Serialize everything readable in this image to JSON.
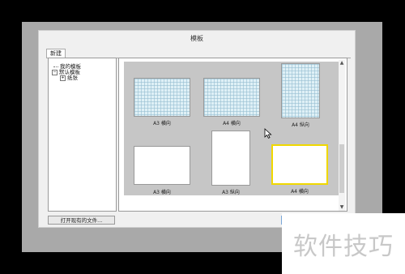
{
  "dialog": {
    "title": "模板"
  },
  "tabs": [
    {
      "label": "新建"
    }
  ],
  "tree": [
    {
      "label": "我的模板",
      "toggle": ""
    },
    {
      "label": "默认模板",
      "toggle": "−"
    },
    {
      "label": "纸张",
      "toggle": "+"
    }
  ],
  "templates": [
    {
      "label": "A3 横向",
      "grid": true,
      "selected": false
    },
    {
      "label": "A4 横向",
      "grid": true,
      "selected": false
    },
    {
      "label": "A4 纵向",
      "grid": true,
      "selected": false
    },
    {
      "label": "A3 横向",
      "grid": false,
      "selected": false
    },
    {
      "label": "A3 纵向",
      "grid": false,
      "selected": false
    },
    {
      "label": "A4 横向",
      "grid": false,
      "selected": true
    }
  ],
  "buttons": {
    "open_existing": "打开现有的文件..."
  },
  "scroll": {
    "up": "▲",
    "down": "▼"
  },
  "watermark": "软件技巧",
  "colors": {
    "selection_border": "#f0d800",
    "preview_bg": "#c6c6c6",
    "grid_paper": "#dff0f6"
  }
}
